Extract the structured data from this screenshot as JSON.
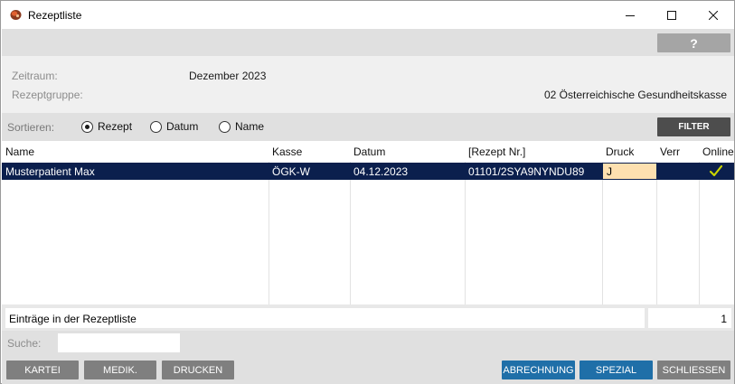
{
  "window": {
    "title": "Rezeptliste",
    "help_label": "?"
  },
  "info": {
    "zeitraum_label": "Zeitraum:",
    "zeitraum_value": "Dezember 2023",
    "gruppe_label": "Rezeptgruppe:",
    "gruppe_value": "02 Österreichische Gesundheitskasse"
  },
  "sort": {
    "label": "Sortieren:",
    "options": [
      {
        "label": "Rezept",
        "selected": true
      },
      {
        "label": "Datum",
        "selected": false
      },
      {
        "label": "Name",
        "selected": false
      }
    ],
    "filter_label": "FILTER"
  },
  "table": {
    "columns": [
      "Name",
      "Kasse",
      "Datum",
      "[Rezept Nr.]",
      "Druck",
      "Verr",
      "Online"
    ],
    "rows": [
      {
        "name": "Musterpatient Max",
        "kasse": "ÖGK-W",
        "datum": "04.12.2023",
        "rezept_nr": "01101/2SYA9NYNDU89",
        "druck": "J",
        "verr": "",
        "online_icon": "checkmark-icon"
      }
    ],
    "selected_row_color": "#0b1f4d",
    "druck_cell_color": "#fde0b0",
    "check_color": "#c9d400"
  },
  "footer": {
    "count_label": "Einträge in der Rezeptliste",
    "count_value": "1",
    "search_label": "Suche:",
    "search_value": "",
    "buttons": {
      "kartei": "KARTEI",
      "medik": "MEDIK.",
      "drucken": "DRUCKEN",
      "abrechnung": "ABRECHNUNG",
      "spezial": "SPEZIAL",
      "schliessen": "SCHLIESSEN"
    }
  }
}
